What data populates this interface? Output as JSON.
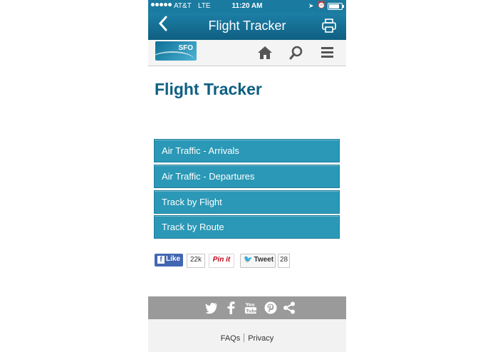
{
  "status_bar": {
    "carrier": "AT&T",
    "network": "LTE",
    "time": "11:20 AM"
  },
  "nav_bar": {
    "title": "Flight Tracker",
    "back_icon": "chevron-left-icon",
    "print_icon": "printer-icon"
  },
  "site_header": {
    "logo_text": "SFO",
    "icons": [
      "home-icon",
      "search-icon",
      "menu-icon"
    ]
  },
  "page": {
    "heading": "Flight Tracker",
    "buttons": [
      "Air Traffic - Arrivals",
      "Air Traffic - Departures",
      "Track by Flight",
      "Track by Route"
    ]
  },
  "social": {
    "like_label": "Like",
    "like_count": "22k",
    "pin_label": "Pin it",
    "tweet_label": "Tweet",
    "tweet_count": "28"
  },
  "footer": {
    "social_icons": [
      "twitter-icon",
      "facebook-icon",
      "youtube-icon",
      "pinterest-icon",
      "share-icon"
    ],
    "links": [
      "FAQs",
      "Privacy"
    ]
  },
  "colors": {
    "brand_blue": "#0e5f82",
    "button_teal": "#2a98b6",
    "footer_gray": "#9a9a9a"
  }
}
